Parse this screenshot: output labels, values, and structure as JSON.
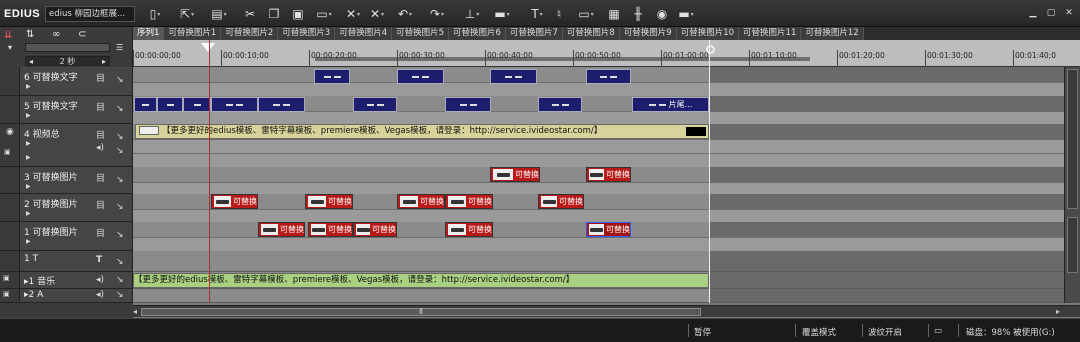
{
  "app": {
    "logo": "EDIUS",
    "project_name": "edius 柳园边框展..."
  },
  "toolbar": {
    "icons": [
      "new-icon",
      "open-icon",
      "save-icon",
      "cut-icon",
      "copy-icon",
      "paste-icon",
      "insert-mode-icon",
      "delete-icon",
      "ripple-icon",
      "undo-icon",
      "redo-icon",
      "set-in-out-icon",
      "track-icon",
      "title-icon",
      "voiceover-icon",
      "render-icon",
      "audio-mixer-icon",
      "effects-icon",
      "marker-icon",
      "view-icon"
    ]
  },
  "left_header": {
    "zoom_label": "2 秒"
  },
  "sequence_tabs": [
    "序列1",
    "可替换图片1",
    "可替换图片2",
    "可替换图片3",
    "可替换图片4",
    "可替换图片5",
    "可替换图片6",
    "可替换图片7",
    "可替换图片8",
    "可替换图片9",
    "可替换图片10",
    "可替换图片11",
    "可替换图片12"
  ],
  "ruler": {
    "labels": [
      "00:00:00;00",
      "00:00:10;00",
      "00:00:20;00",
      "00:00:30;00",
      "00:00:40;00",
      "00:00:50;00",
      "00:01:00;00",
      "00:01:10;00",
      "00:01:20;00",
      "00:01:30;00",
      "00:01:40;0"
    ]
  },
  "tracks": [
    {
      "id": "6",
      "name": "6 可替换文字"
    },
    {
      "id": "5",
      "name": "5 可替换文字"
    },
    {
      "id": "4",
      "name": "4 视频总"
    },
    {
      "id": "3",
      "name": "3 可替换图片"
    },
    {
      "id": "2",
      "name": "2 可替换图片"
    },
    {
      "id": "1",
      "name": "1 可替换图片"
    },
    {
      "id": "T1",
      "name": "1 T"
    },
    {
      "id": "A1",
      "name": "▸1 音乐"
    },
    {
      "id": "A2",
      "name": "▸2 A"
    }
  ],
  "clips": {
    "track5_last_label": "片尾...",
    "red_clip_label": "可替换",
    "video_banner": "【更多更好的edius模板、雷特字幕模板、premiere模板、Vegas模板，请登录：http://service.ivideostar.com/】",
    "audio_banner": "【更多更好的edius模板、雷特字幕模板、premiere模板、Vegas模板，请登录：http://service.ivideostar.com/】"
  },
  "status": {
    "playback": "暂停",
    "mode": "覆盖模式",
    "ripple": "波纹开启",
    "disk": "磁盘：98% 被使用(G:)"
  },
  "colors": {
    "video_banner": "#d8d39a",
    "audio_banner": "#a8d080",
    "text_clip": "#1e1e6e",
    "image_clip": "#b81a1a",
    "ruler": "#bdbdbd"
  }
}
